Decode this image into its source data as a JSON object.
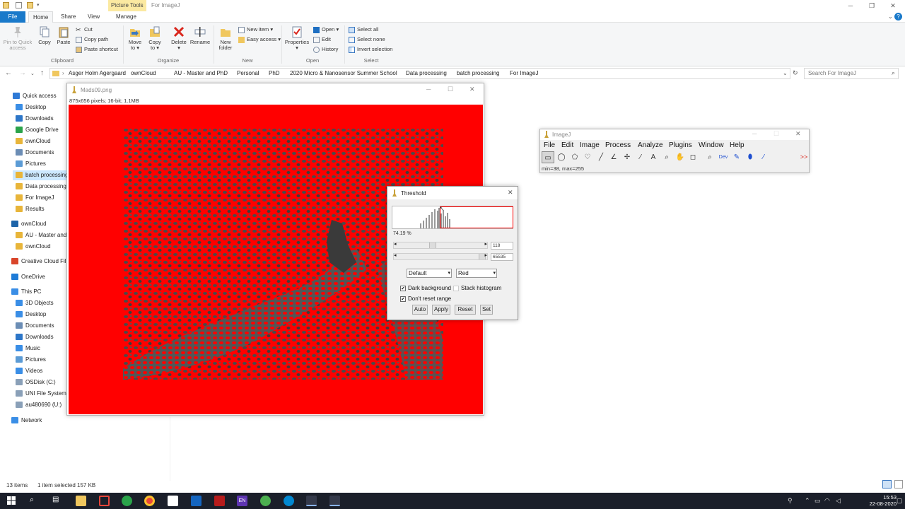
{
  "explorer": {
    "contextual_tab": "Picture Tools",
    "folder_title": "For ImageJ",
    "tabs": [
      "File",
      "Home",
      "Share",
      "View",
      "Manage"
    ],
    "clipboard": {
      "pin": "Pin to Quick access",
      "copy": "Copy",
      "paste": "Paste",
      "cut": "Cut",
      "copy_path": "Copy path",
      "paste_shortcut": "Paste shortcut",
      "label": "Clipboard"
    },
    "organize": {
      "move_to": "Move to",
      "copy_to": "Copy to",
      "delete": "Delete",
      "rename": "Rename",
      "label": "Organize"
    },
    "new": {
      "new_folder": "New folder",
      "new_item": "New item",
      "easy_access": "Easy access",
      "label": "New"
    },
    "open": {
      "properties": "Properties",
      "open": "Open",
      "edit": "Edit",
      "history": "History",
      "label": "Open"
    },
    "select": {
      "select_all": "Select all",
      "select_none": "Select none",
      "invert": "Invert selection",
      "label": "Select"
    },
    "breadcrumbs": [
      "Asger Holm Agergaard",
      "ownCloud",
      "AU - Master and PhD",
      "Personal",
      "PhD",
      "2020 Micro & Nanosensor Summer School",
      "Data processing",
      "batch processing",
      "For ImageJ"
    ],
    "search_placeholder": "Search For ImageJ",
    "nav": [
      {
        "label": "Quick access",
        "color": "#2f7ad6"
      },
      {
        "label": "Desktop",
        "color": "#3a8ee6"
      },
      {
        "label": "Downloads",
        "color": "#2d76c8"
      },
      {
        "label": "Google Drive",
        "color": "#2aa34a"
      },
      {
        "label": "ownCloud",
        "color": "#e8b53a"
      },
      {
        "label": "Documents",
        "color": "#6b8db5"
      },
      {
        "label": "Pictures",
        "color": "#5b9bd5"
      },
      {
        "label": "batch processing",
        "color": "#e8b53a"
      },
      {
        "label": "Data processing",
        "color": "#e8b53a"
      },
      {
        "label": "For ImageJ",
        "color": "#e8b53a"
      },
      {
        "label": "Results",
        "color": "#e8b53a"
      },
      {
        "label": "ownCloud",
        "color": "#1d64a8"
      },
      {
        "label": "AU - Master and",
        "color": "#e8b53a"
      },
      {
        "label": "ownCloud",
        "color": "#e8b53a"
      },
      {
        "label": "Creative Cloud File",
        "color": "#d9452a"
      },
      {
        "label": "OneDrive",
        "color": "#1e7bd7"
      },
      {
        "label": "This PC",
        "color": "#3a8ee6"
      },
      {
        "label": "3D Objects",
        "color": "#3a8ee6"
      },
      {
        "label": "Desktop",
        "color": "#3a8ee6"
      },
      {
        "label": "Documents",
        "color": "#6b8db5"
      },
      {
        "label": "Downloads",
        "color": "#2d76c8"
      },
      {
        "label": "Music",
        "color": "#3a8ee6"
      },
      {
        "label": "Pictures",
        "color": "#5b9bd5"
      },
      {
        "label": "Videos",
        "color": "#3a8ee6"
      },
      {
        "label": "OSDisk (C:)",
        "color": "#8aa0b8"
      },
      {
        "label": "UNI File System (",
        "color": "#8aa0b8"
      },
      {
        "label": "au480690 (U:)",
        "color": "#8aa0b8"
      },
      {
        "label": "Network",
        "color": "#3a8ee6"
      }
    ],
    "status": {
      "items": "13 items",
      "selected": "1 item selected  157 KB"
    }
  },
  "image_window": {
    "title": "Mads09.png",
    "info": "875x656 pixels; 16-bit; 1.1MB"
  },
  "imagej": {
    "title": "ImageJ",
    "menu": [
      "File",
      "Edit",
      "Image",
      "Process",
      "Analyze",
      "Plugins",
      "Window",
      "Help"
    ],
    "dev_label": "Dev",
    "more_tools": ">>",
    "status": "min=38, max=255"
  },
  "threshold": {
    "title": "Threshold",
    "percent": "74.19 %",
    "min_value": "118",
    "max_value": "65535",
    "method": "Default",
    "mode": "Red",
    "dark_background": "Dark background",
    "stack_histogram": "Stack histogram",
    "dont_reset": "Don't reset range",
    "buttons": {
      "auto": "Auto",
      "apply": "Apply",
      "reset": "Reset",
      "set": "Set"
    }
  },
  "taskbar": {
    "time": "15:53",
    "date": "22-08-2020",
    "lang": "EN"
  }
}
